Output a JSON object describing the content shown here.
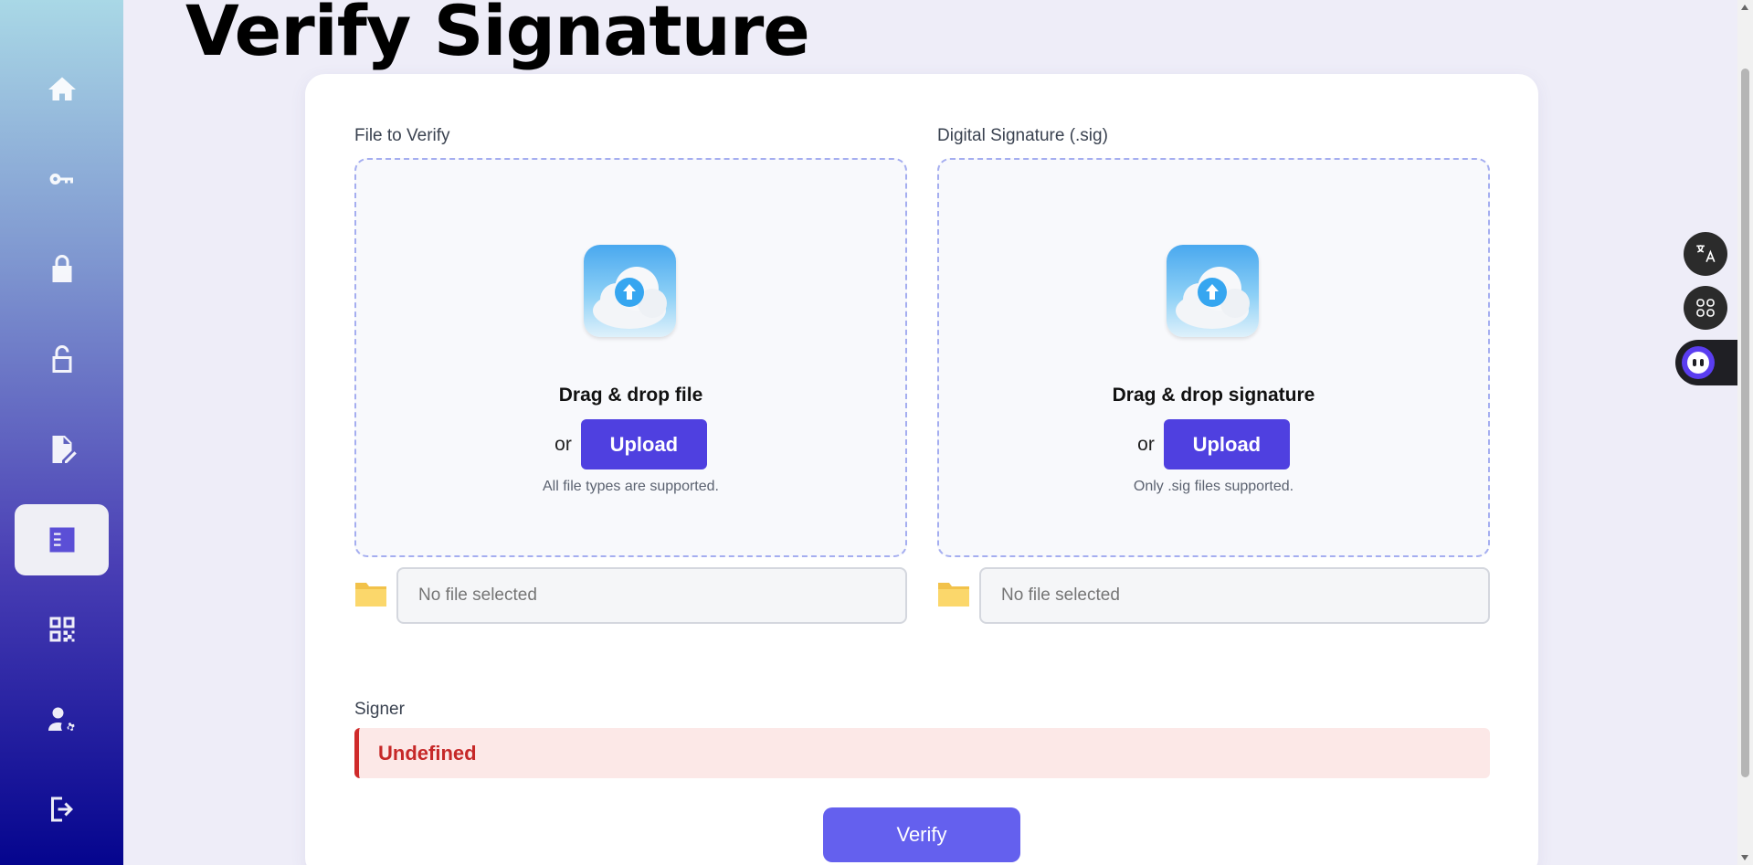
{
  "page": {
    "title": "Verify Signature"
  },
  "sidebar": {
    "items": [
      {
        "id": "home",
        "icon": "home-icon"
      },
      {
        "id": "keys",
        "icon": "key-icon"
      },
      {
        "id": "encrypt",
        "icon": "lock-icon"
      },
      {
        "id": "decrypt",
        "icon": "unlock-icon"
      },
      {
        "id": "sign",
        "icon": "file-signature-icon"
      },
      {
        "id": "verify",
        "icon": "verify-checklist-icon",
        "active": true
      },
      {
        "id": "qr",
        "icon": "qr-code-icon"
      },
      {
        "id": "account",
        "icon": "user-settings-icon"
      },
      {
        "id": "logout",
        "icon": "logout-icon"
      }
    ]
  },
  "file_section": {
    "label": "File to Verify",
    "dropzone_title": "Drag & drop file",
    "or_text": "or",
    "upload_label": "Upload",
    "hint": "All file types are supported.",
    "selected_placeholder": "No file selected"
  },
  "signature_section": {
    "label": "Digital Signature (.sig)",
    "dropzone_title": "Drag & drop signature",
    "or_text": "or",
    "upload_label": "Upload",
    "hint": "Only .sig files supported.",
    "selected_placeholder": "No file selected"
  },
  "signer": {
    "label": "Signer",
    "value": "Undefined"
  },
  "actions": {
    "verify_label": "Verify"
  },
  "floating": {
    "translate_icon": "translate-icon",
    "apps_icon": "apps-icon",
    "assistant_icon": "assistant-face-icon"
  },
  "colors": {
    "primary": "#4f40e0",
    "verify": "#6460ee",
    "error_text": "#c62828",
    "error_bg": "#fce8e7"
  }
}
